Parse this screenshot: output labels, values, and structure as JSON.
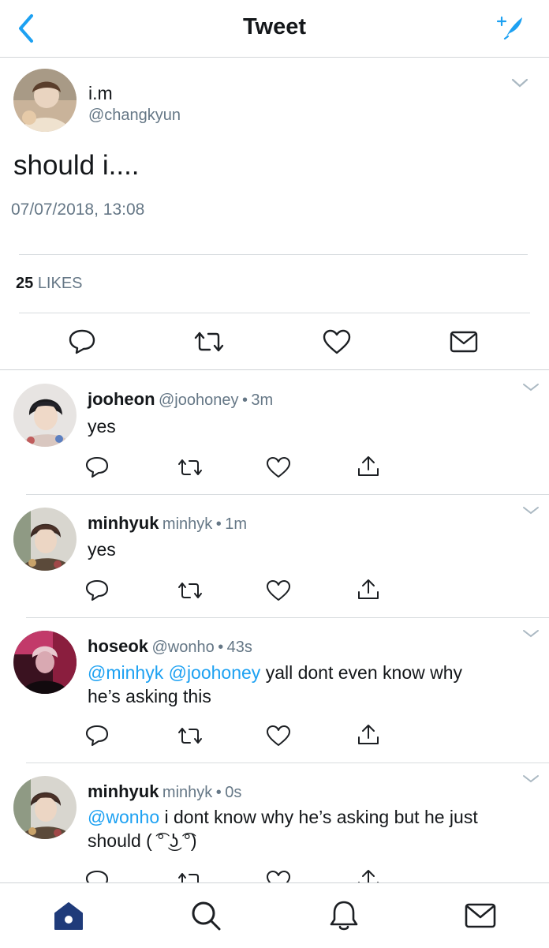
{
  "header": {
    "title": "Tweet"
  },
  "tweet": {
    "display_name": "i.m",
    "handle": "@changkyun",
    "text": "should i....",
    "timestamp": "07/07/2018, 13:08",
    "likes_count": "25",
    "likes_label": "LIKES"
  },
  "replies": [
    {
      "name": "jooheon",
      "handle": "@joohoney",
      "time": "3m",
      "mentions": "",
      "text": "yes",
      "text2": ""
    },
    {
      "name": "minhyuk",
      "handle": "minhyk",
      "time": "1m",
      "mentions": "",
      "text": "yes",
      "text2": ""
    },
    {
      "name": "hoseok",
      "handle": "@wonho",
      "time": "43s",
      "mentions": "@minhyk @joohoney",
      "text": " yall dont even know why",
      "text2": "he’s asking this"
    },
    {
      "name": "minhyuk",
      "handle": "minhyk",
      "time": "0s",
      "mentions": "@wonho",
      "text": " i dont know why he’s asking but he just",
      "text2": "should ( ͡° ͜ʖ ͡°)"
    }
  ],
  "separator": "•",
  "colors": {
    "accent": "#1da1f2",
    "nav_active": "#1f3b7a",
    "muted": "#657786"
  },
  "icons": {
    "header": [
      "back-icon",
      "compose-icon"
    ],
    "actions": [
      "reply-icon",
      "retweet-icon",
      "like-icon",
      "message-icon",
      "share-icon",
      "chevron-down-icon"
    ],
    "bottom_nav": [
      "home-icon",
      "search-icon",
      "notifications-icon",
      "messages-icon"
    ]
  }
}
